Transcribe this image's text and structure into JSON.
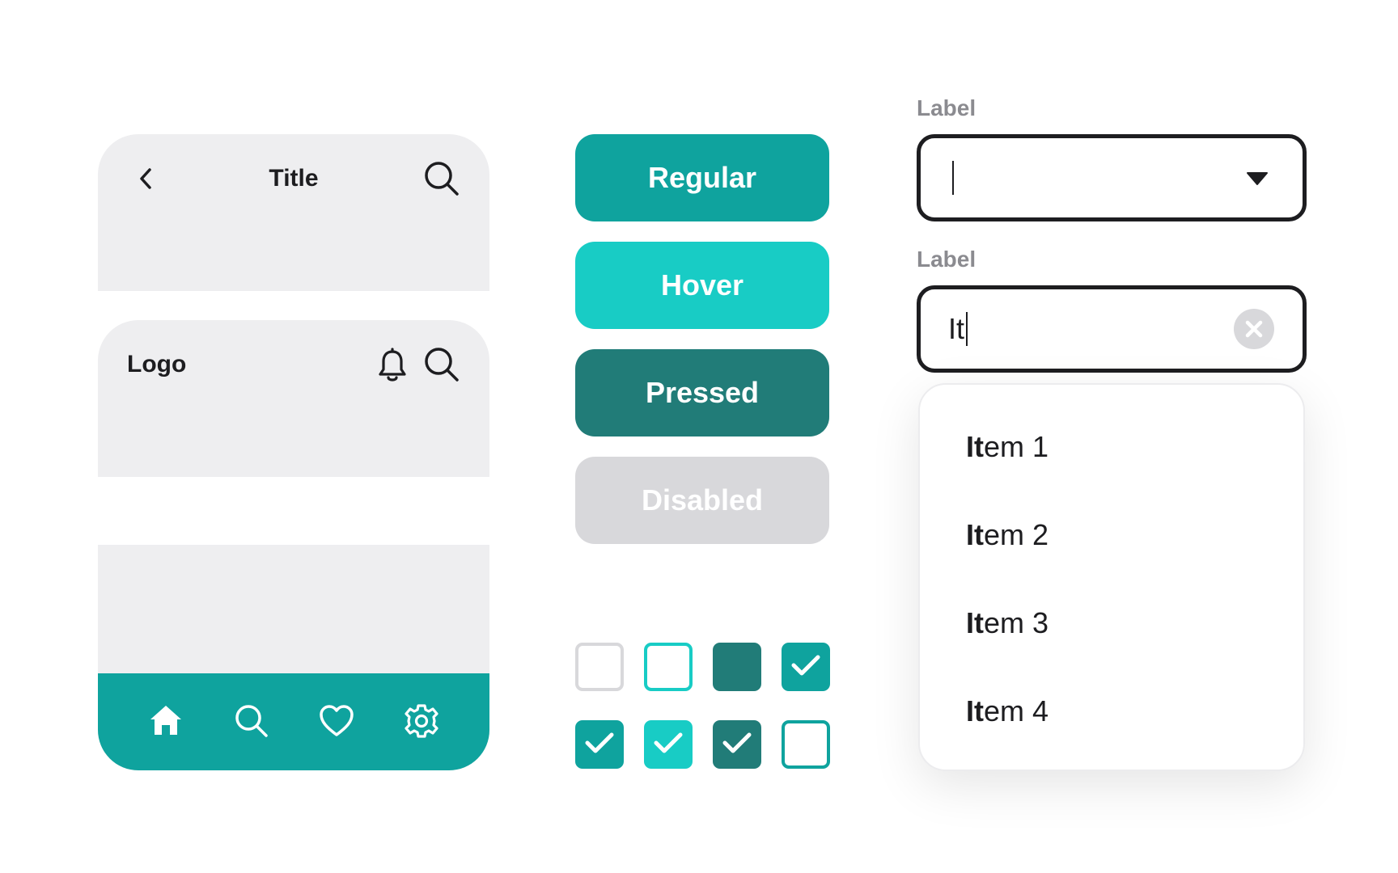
{
  "top_app_bar": {
    "title": "Title",
    "back_icon": "chevron-left-icon",
    "search_icon": "search-icon"
  },
  "logo_app_bar": {
    "logo": "Logo",
    "bell_icon": "bell-icon",
    "search_icon": "search-icon"
  },
  "bottom_nav": {
    "background": "#0fa39e",
    "items": [
      "home-icon",
      "search-icon",
      "heart-icon",
      "gear-icon"
    ],
    "active": "home-icon"
  },
  "buttons": [
    {
      "label": "Regular",
      "state": "regular",
      "color": "#0fa39e"
    },
    {
      "label": "Hover",
      "state": "hover",
      "color": "#18ccc5"
    },
    {
      "label": "Pressed",
      "state": "pressed",
      "color": "#217c78"
    },
    {
      "label": "Disabled",
      "state": "disabled",
      "color": "#d8d8db"
    }
  ],
  "checkboxes": {
    "row1": [
      "unchecked-default",
      "unchecked-hover",
      "unchecked-pressed",
      "checked"
    ],
    "row2": [
      "checked",
      "checked-hover",
      "checked-pressed",
      "unchecked-focused"
    ]
  },
  "select_field": {
    "label": "Label",
    "value": "",
    "icon": "caret-down-icon"
  },
  "search_field": {
    "label": "Label",
    "value": "It",
    "icon": "clear-icon"
  },
  "dropdown": {
    "items": [
      {
        "match": "It",
        "rest": "em 1"
      },
      {
        "match": "It",
        "rest": "em 2"
      },
      {
        "match": "It",
        "rest": "em 3"
      },
      {
        "match": "It",
        "rest": "em 4"
      }
    ]
  },
  "colors": {
    "teal": "#0fa39e",
    "teal_hover": "#18ccc5",
    "teal_pressed": "#217c78",
    "disabled": "#d8d8db",
    "surface": "#eeeef0",
    "text": "#1d1d20",
    "label": "#8b8b90"
  }
}
